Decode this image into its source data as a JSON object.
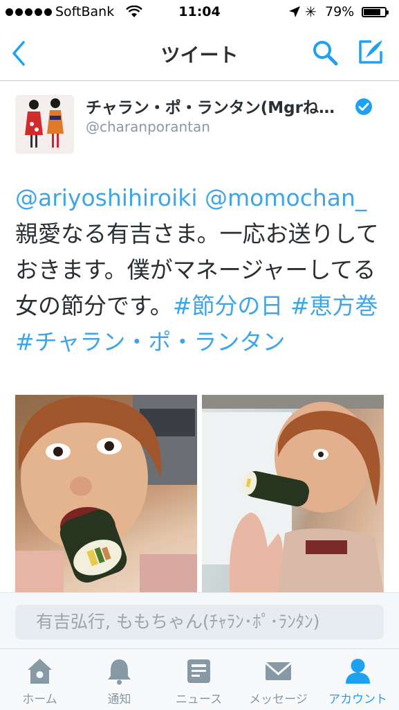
{
  "status_bar": {
    "carrier": "SoftBank",
    "time": "11:04",
    "battery": "79%",
    "battery_level": 0.79
  },
  "nav": {
    "title": "ツイート",
    "icons": [
      "back-chevron-icon",
      "search-icon",
      "compose-tweet-icon"
    ]
  },
  "tweet": {
    "author_name": "チャラン・ポ・ランタン(Mgrね…",
    "author_handle": "@charanporantan",
    "verified": true,
    "mention_1": "@ariyoshihiroiki",
    "mention_2": "@momochan_",
    "body": "親愛なる有吉さま。一応お送りしておきます。僕がマネージャーしてる女の節分です。",
    "hashtag_1": "#節分の日",
    "hashtag_2": "#恵方巻",
    "hashtag_3": "#チャラン・ポ・ランタン",
    "photo_count": 2
  },
  "reply": {
    "placeholder": "有吉弘行, ももちゃん(ﾁｬﾗﾝ･ﾎﾟ･ﾗﾝﾀﾝ)"
  },
  "tabs": [
    {
      "label": "ホーム",
      "icon": "home-icon"
    },
    {
      "label": "通知",
      "icon": "bell-icon"
    },
    {
      "label": "ニュース",
      "icon": "news-icon"
    },
    {
      "label": "メッセージ",
      "icon": "envelope-icon"
    },
    {
      "label": "アカウント",
      "icon": "person-icon",
      "active": true
    }
  ],
  "colors": {
    "accent": "#1da1f2",
    "link": "#3ea5e8",
    "text": "#292f33",
    "muted": "#8899a6"
  }
}
